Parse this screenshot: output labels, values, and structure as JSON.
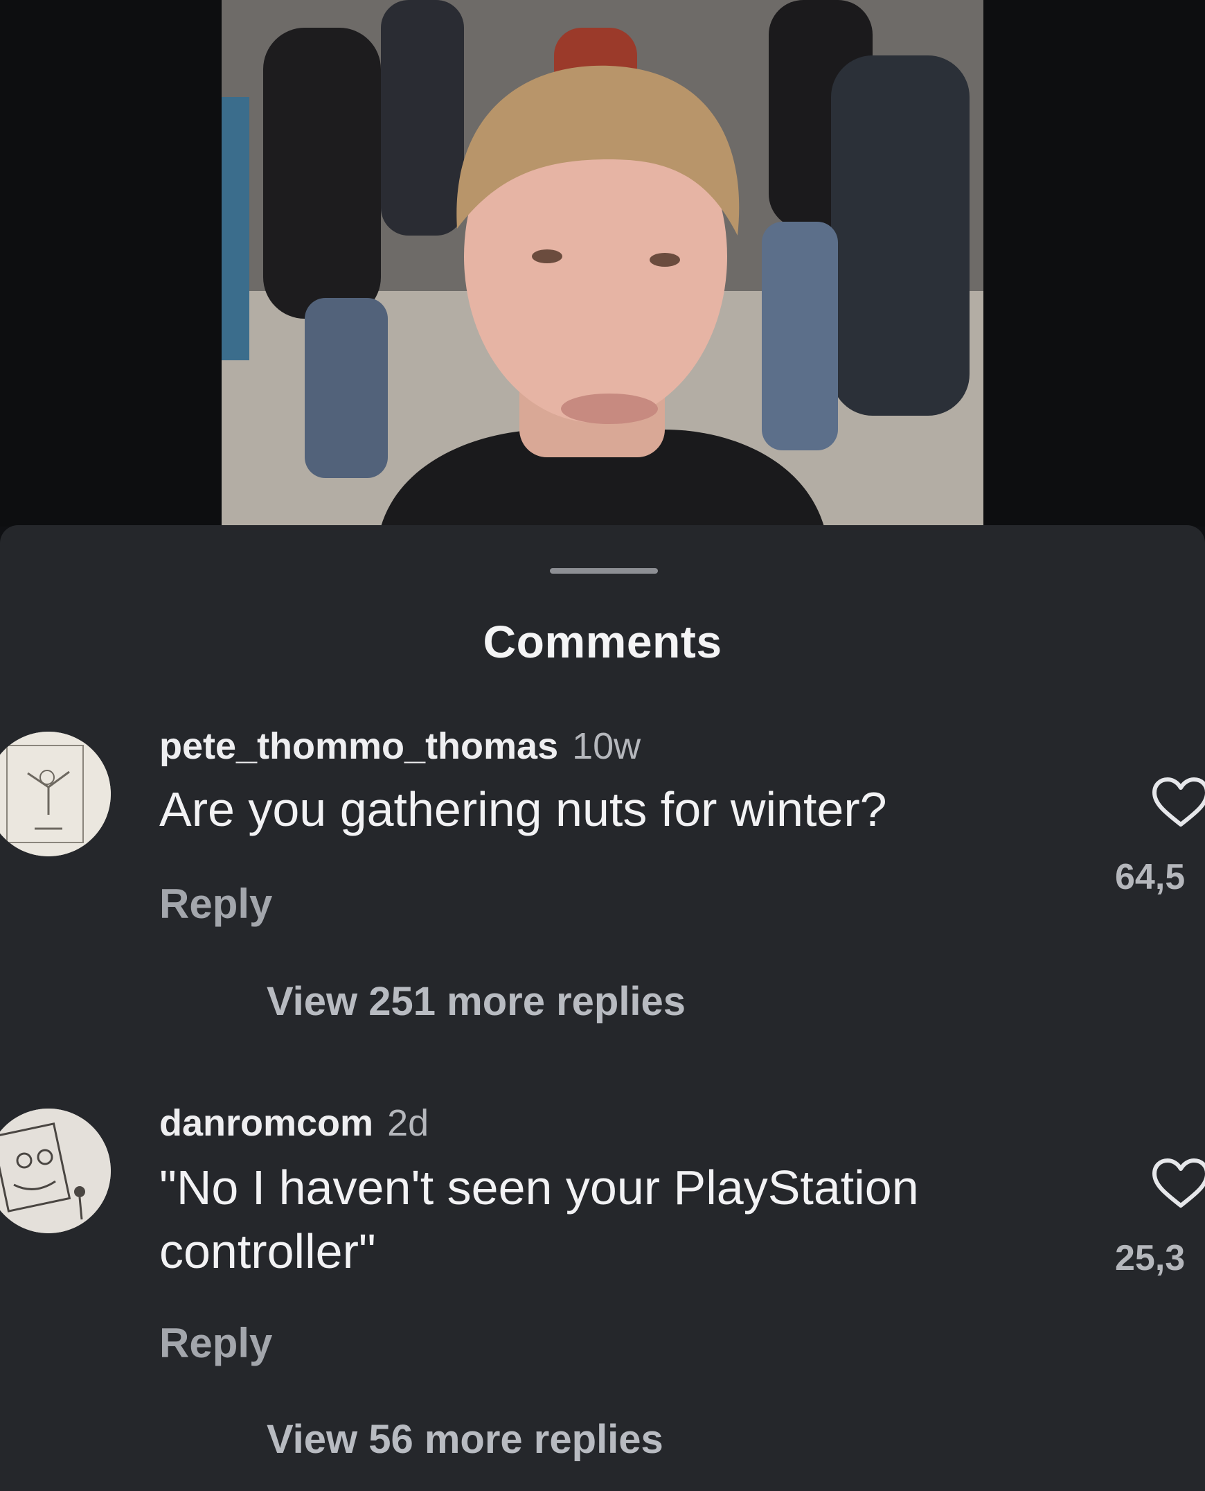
{
  "sheet": {
    "title": "Comments"
  },
  "comments": [
    {
      "username": "pete_thommo_thomas",
      "time": "10w",
      "text": "Are you gathering nuts for winter?",
      "reply_label": "Reply",
      "likes": "64,5",
      "view_more": "View 251 more replies"
    },
    {
      "username": "danromcom",
      "time": "2d",
      "text": "\"No I haven't seen your PlayStation controller\"",
      "reply_label": "Reply",
      "likes": "25,3",
      "view_more": "View 56 more replies"
    }
  ],
  "icons": {
    "like": "heart-icon",
    "drag": "drag-handle"
  },
  "colors": {
    "sheet_bg": "#25272b",
    "text_primary": "#f2f2f4",
    "text_secondary": "#a3a6ac"
  }
}
